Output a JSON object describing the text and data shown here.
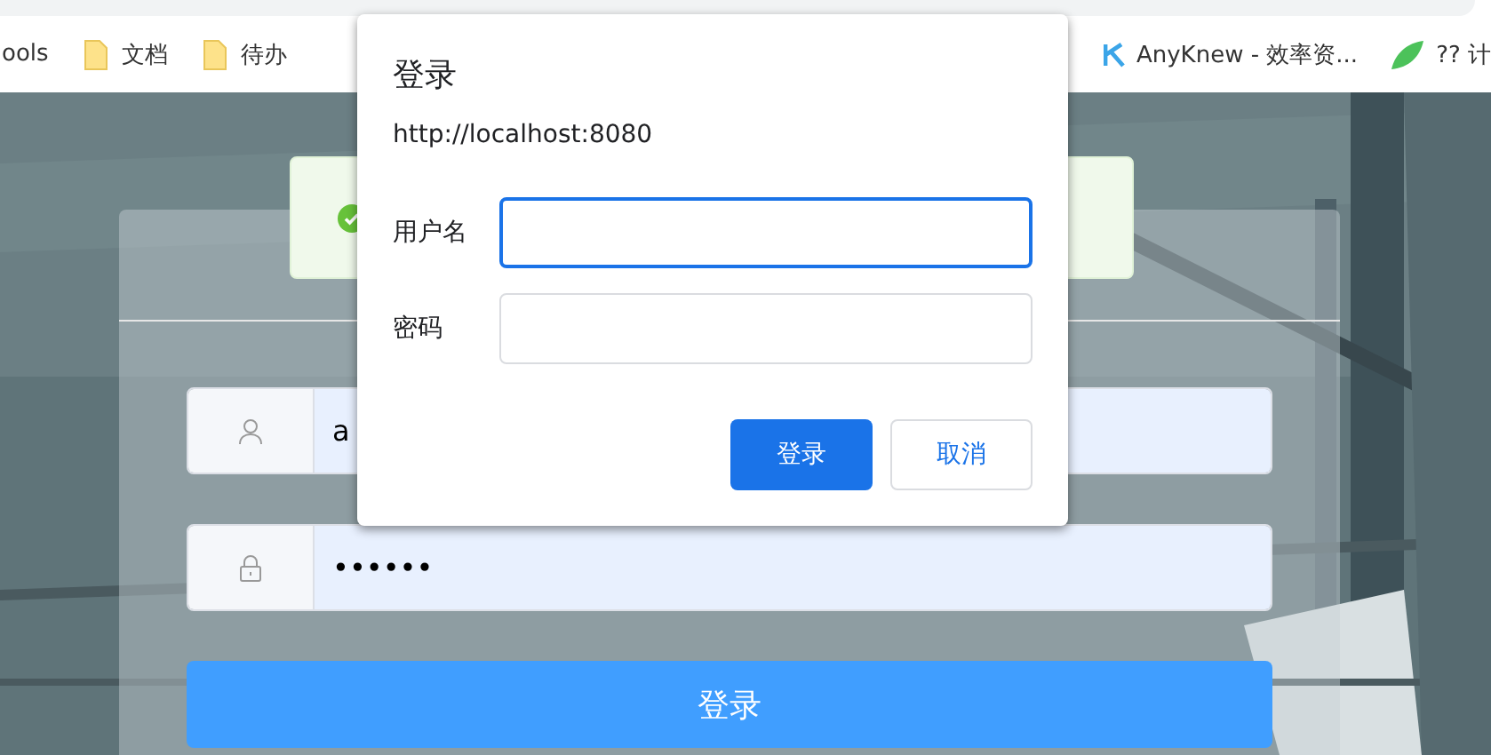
{
  "bookmarks": [
    {
      "label": "ools",
      "kind": "plain"
    },
    {
      "label": "文档",
      "kind": "folder"
    },
    {
      "label": "待办",
      "kind": "folder"
    },
    {
      "label": "AnyKnew - 效率资...",
      "kind": "k"
    },
    {
      "label": "?? 计",
      "kind": "leaf"
    }
  ],
  "alert": {
    "kind": "success"
  },
  "login_form": {
    "fields": [
      {
        "kind": "user",
        "value": "a"
      },
      {
        "kind": "lock",
        "value": "••••••"
      }
    ],
    "submit": "登录"
  },
  "dialog": {
    "title": "登录",
    "origin": "http://localhost:8080",
    "fields": [
      {
        "label": "用户名",
        "focused": true
      },
      {
        "label": "密码",
        "focused": false
      }
    ],
    "buttons": [
      {
        "label": "登录",
        "primary": true
      },
      {
        "label": "取消",
        "primary": false
      }
    ]
  }
}
